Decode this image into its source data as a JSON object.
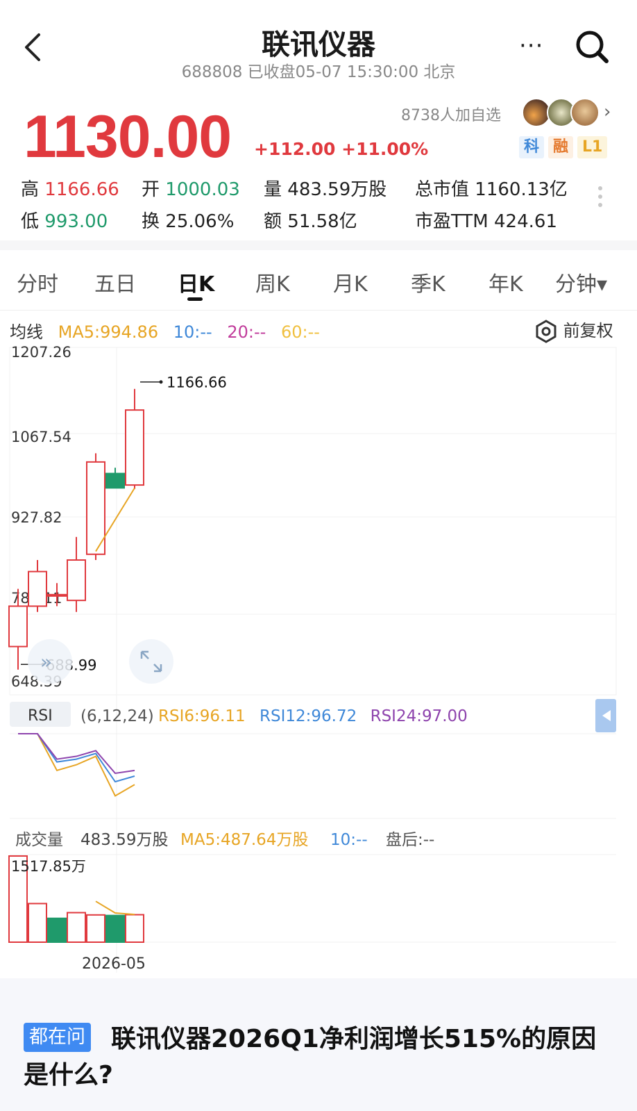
{
  "header": {
    "title": "联讯仪器",
    "subtitle": "688808 已收盘05-07 15:30:00 北京",
    "more_label": "···"
  },
  "quote": {
    "price": "1130.00",
    "change": "+112.00 +11.00%",
    "watchers": "8738人加自选",
    "tags": [
      "科",
      "融",
      "L1"
    ]
  },
  "stats": {
    "high_label": "高",
    "high": "1166.66",
    "open_label": "开",
    "open": "1000.03",
    "volume_label": "量",
    "volume": "483.59万股",
    "mcap_label": "总市值",
    "mcap": "1160.13亿",
    "low_label": "低",
    "low": "993.00",
    "turnover_label": "换",
    "turnover": "25.06%",
    "amount_label": "额",
    "amount": "51.58亿",
    "pe_label": "市盈TTM",
    "pe": "424.61"
  },
  "tabs": [
    "分时",
    "五日",
    "日K",
    "周K",
    "月K",
    "季K",
    "年K",
    "分钟▾"
  ],
  "active_tab": "日K",
  "ma": {
    "label": "均线",
    "ma5": "MA5:994.86",
    "ma10": "10:--",
    "ma20": "20:--",
    "ma60": "60:--",
    "adjust": "前复权"
  },
  "colors": {
    "up": "#e0393e",
    "down": "#1f9a6b",
    "ma5": "#e7a524",
    "ma10": "#3f88d8",
    "ma20": "#c13c9b",
    "ma60": "#f0c040",
    "rsi6": "#e7a524",
    "rsi12": "#3f88d8",
    "rsi24": "#8e44ad"
  },
  "chart_data": [
    {
      "type": "candlestick",
      "y_ticks": [
        "1207.26",
        "1067.54",
        "927.82",
        "788.11",
        "648.39"
      ],
      "ylim": [
        648.39,
        1207.26
      ],
      "candles": [
        {
          "open": 720,
          "close": 790,
          "high": 820,
          "low": 680
        },
        {
          "open": 790,
          "close": 850,
          "high": 870,
          "low": 780
        },
        {
          "open": 810,
          "close": 810,
          "high": 830,
          "low": 790
        },
        {
          "open": 800,
          "close": 870,
          "high": 910,
          "low": 780
        },
        {
          "open": 880,
          "close": 1040,
          "high": 1055,
          "low": 870
        },
        {
          "open": 1020,
          "close": 995,
          "high": 1030,
          "low": 995
        },
        {
          "open": 1000,
          "close": 1130,
          "high": 1166.66,
          "low": 993
        }
      ],
      "ma5": [
        null,
        null,
        null,
        null,
        885,
        940,
        994.86
      ],
      "max_label": "1166.66",
      "min_label": "688.99"
    },
    {
      "type": "line",
      "name": "RSI",
      "label": "RSI",
      "params": "(6,12,24)",
      "series": [
        {
          "name": "RSI6:96.11",
          "values": [
            100,
            100,
            87,
            89,
            92,
            78,
            82
          ]
        },
        {
          "name": "RSI12:96.72",
          "values": [
            100,
            100,
            90,
            91,
            93,
            83,
            85
          ]
        },
        {
          "name": "RSI24:97.00",
          "values": [
            100,
            100,
            91,
            92,
            94,
            86,
            87
          ]
        }
      ]
    },
    {
      "type": "bar",
      "name": "成交量",
      "label": "成交量",
      "value": "483.59万股",
      "ma5": "MA5:487.64万股",
      "ma10": "10:--",
      "after_hours": "盘后:--",
      "max_label": "1517.85万",
      "x_label": "2026-05",
      "values": [
        1517.85,
        680,
        420,
        520,
        480,
        470,
        483.59
      ],
      "directions": [
        "up",
        "up",
        "down",
        "up",
        "up",
        "down",
        "up"
      ],
      "ma5_line": [
        null,
        null,
        null,
        null,
        720,
        514,
        487.64
      ]
    }
  ],
  "question": {
    "badge": "都在问",
    "text": "联讯仪器2026Q1净利润增长515%的原因是什么?"
  }
}
